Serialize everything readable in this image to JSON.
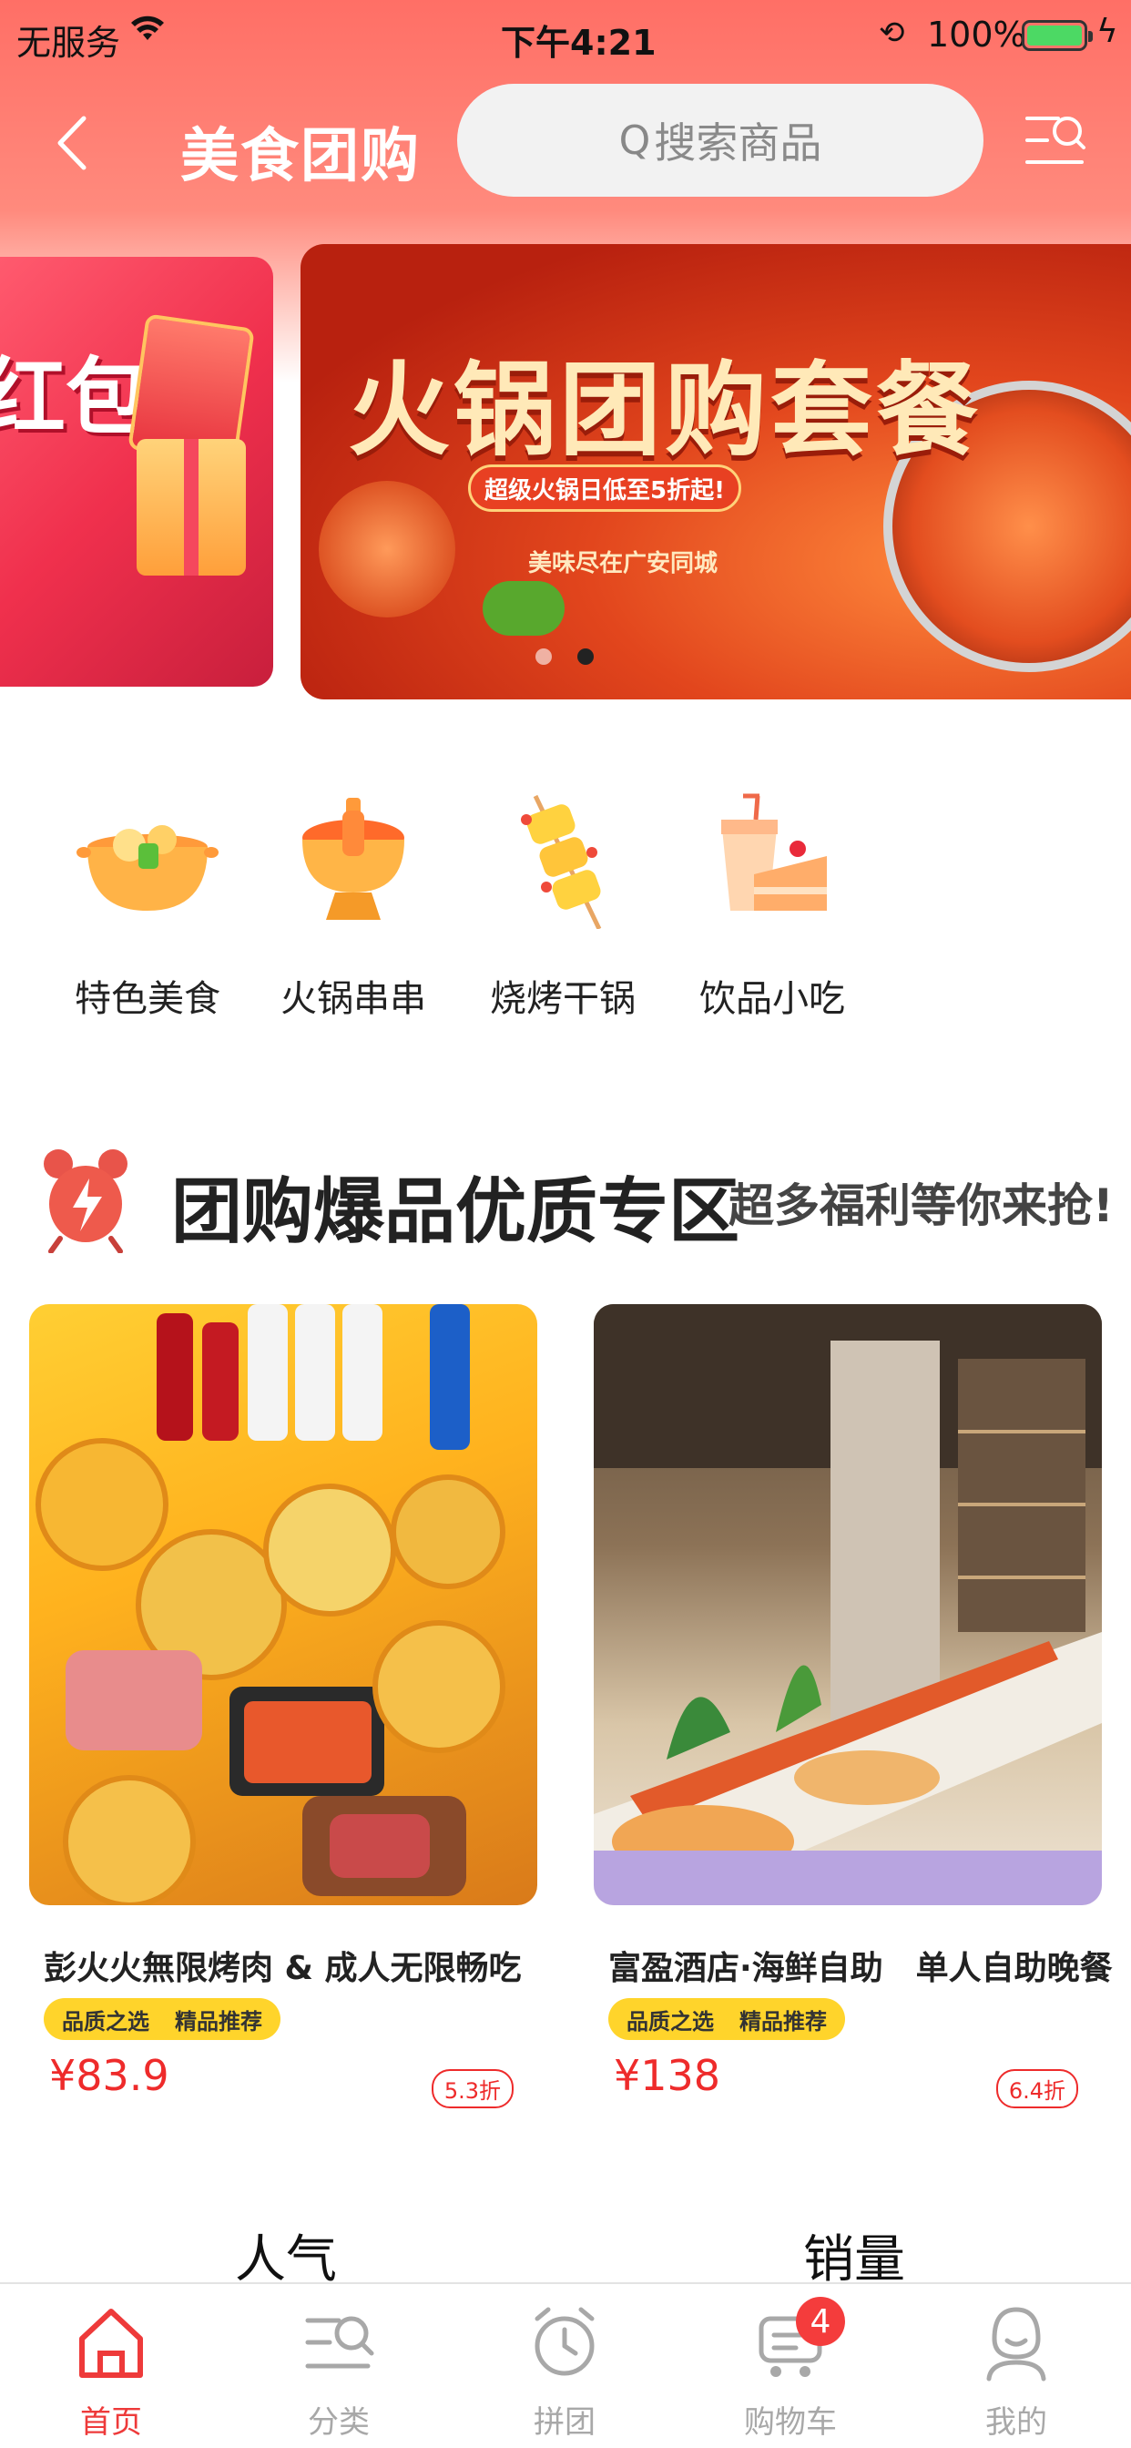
{
  "status_bar": {
    "carrier": "无服务",
    "time": "下午4:21",
    "battery": "100%"
  },
  "nav": {
    "title": "美食团购",
    "search_placeholder": "搜索商品"
  },
  "banners": [
    {
      "text": "红包位"
    },
    {
      "title": "火锅团购套餐",
      "pill": "超级火锅日低至5折起!",
      "sub": "美味尽在广安同城"
    }
  ],
  "categories": [
    {
      "label": "特色美食",
      "icon": "soup-bowl-icon"
    },
    {
      "label": "火锅串串",
      "icon": "hotpot-icon"
    },
    {
      "label": "烧烤干锅",
      "icon": "skewer-icon"
    },
    {
      "label": "饮品小吃",
      "icon": "drink-cake-icon"
    }
  ],
  "section": {
    "title": "团购爆品优质专区",
    "subtitle": "超多福利等你来抢!"
  },
  "products": [
    {
      "name": "彭火火無限烤肉 & 成人无限畅吃",
      "tags": [
        "品质之选",
        "精品推荐"
      ],
      "price": "¥83.9",
      "discount": "5.3折"
    },
    {
      "name": "富盈酒店·海鲜自助　单人自助晚餐",
      "tags": [
        "品质之选",
        "精品推荐"
      ],
      "price": "¥138",
      "discount": "6.4折"
    }
  ],
  "sort_tabs": [
    "人气",
    "销量"
  ],
  "tab_bar": [
    {
      "label": "首页",
      "icon": "home-icon",
      "active": true
    },
    {
      "label": "分类",
      "icon": "category-search-icon",
      "active": false
    },
    {
      "label": "拼团",
      "icon": "alarm-clock-icon",
      "active": false
    },
    {
      "label": "购物车",
      "icon": "cart-icon",
      "active": false,
      "badge": "4"
    },
    {
      "label": "我的",
      "icon": "user-icon",
      "active": false
    }
  ],
  "colors": {
    "accent": "#ee3a3a",
    "header_gradient_top": "#ff6f66",
    "tag_yellow": "#ffd42b"
  }
}
